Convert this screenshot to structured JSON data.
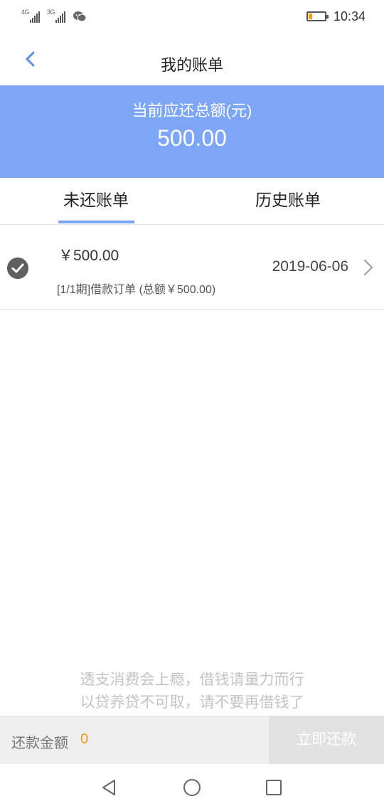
{
  "status_bar": {
    "network1": "4G",
    "network2": "3G",
    "time": "10:34",
    "battery_level": 0.2,
    "icons": [
      "signal-icon",
      "signal-icon",
      "wechat-icon",
      "battery-icon"
    ]
  },
  "header": {
    "title": "我的账单",
    "back_icon": "back-chevron-icon"
  },
  "summary": {
    "label": "当前应还总额(元)",
    "amount": "500.00"
  },
  "tabs": [
    {
      "label": "未还账单",
      "active": true
    },
    {
      "label": "历史账单",
      "active": false
    }
  ],
  "bills": [
    {
      "amount": "￥500.00",
      "description": "[1/1期]借款订单 (总额￥500.00)",
      "date": "2019-06-06",
      "selected": true
    }
  ],
  "notice": {
    "line1": "透支消费会上瘾，借钱请量力而行",
    "line2": "以贷养贷不可取，请不要再借钱了"
  },
  "footer": {
    "label": "还款金额",
    "value": "0",
    "button": "立即还款"
  },
  "colors": {
    "accent": "#7ea6f8",
    "highlight": "#f39c12",
    "disabled_button": "#e1e1e1"
  }
}
